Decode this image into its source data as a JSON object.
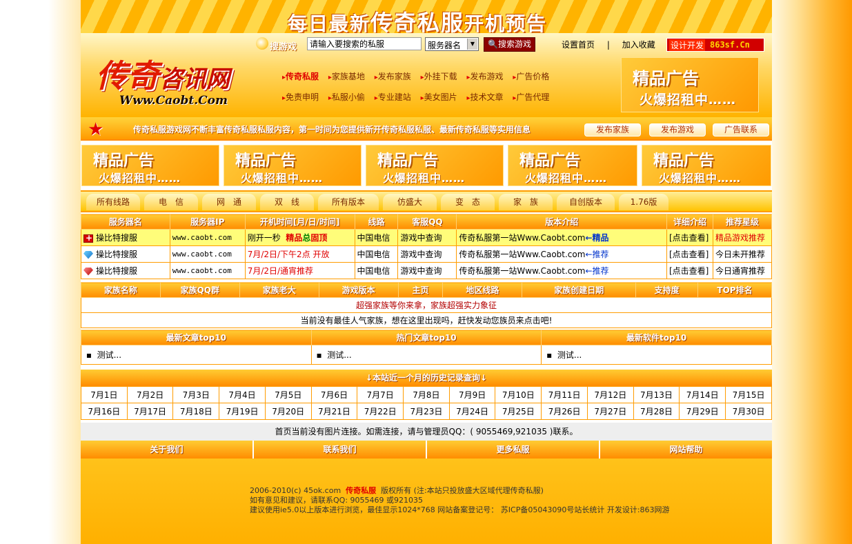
{
  "banner": {
    "title_pre": "每日最新",
    "title_main": "传奇私服",
    "title_post": "开机预告"
  },
  "logo": {
    "cn": "传奇",
    "cn_small": "咨讯网",
    "url": "Www.Caobt.Com"
  },
  "search": {
    "label": "搜游戏",
    "placeholder": "请输入要搜索的私服",
    "select_value": "服务器名",
    "button": "搜索游戏"
  },
  "top_links": [
    "设置首页",
    "|",
    "加入收藏"
  ],
  "dev": {
    "label": "设计开发",
    "site": "863sf.Cn"
  },
  "nav": {
    "row1": [
      "传奇私服",
      "家族基地",
      "发布家族",
      "外挂下载",
      "发布游戏",
      "广告价格"
    ],
    "row2": [
      "免责申明",
      "私服小偷",
      "专业建站",
      "美女图片",
      "技术文章",
      "广告代理"
    ]
  },
  "ad": {
    "line1": "精品广告",
    "line2": "火爆招租中……"
  },
  "notice": {
    "text": "传奇私服游戏网不断丰富传奇私服私服内容，第一时间为您提供新开传奇私服私服、最新传奇私服等实用信息",
    "buttons": [
      "发布家族",
      "发布游戏",
      "广告联系"
    ]
  },
  "filters": [
    "所有线路",
    "电　信",
    "网　通",
    "双　线",
    "所有版本",
    "仿盛大",
    "变　态",
    "家　族",
    "自创版本",
    "1.76版"
  ],
  "servers": {
    "headers": [
      "服务器名",
      "服务器IP",
      "开机时间[月/日/时间]",
      "线路",
      "客服QQ",
      "版本介绍",
      "详细介绍",
      "推荐星级"
    ],
    "rows": [
      {
        "name": "操比特搜服",
        "ip": "www.caobt.com",
        "time_a": "刚开一秒",
        "time_b": "精品",
        "time_c": "总",
        "time_d": "固顶",
        "line": "中国电信",
        "qq": "游戏中查询",
        "intro": "传奇私服第一站Www.Caobt.com",
        "intro_tag": "←精品",
        "detail": "[点击查看]",
        "rec": "精品游戏推荐"
      },
      {
        "name": "操比特搜服",
        "ip": "www.caobt.com",
        "time_a": "7月/2日/下午2点 开放",
        "line": "中国电信",
        "qq": "游戏中查询",
        "intro": "传奇私服第一站Www.Caobt.com",
        "intro_tag": "←推荐",
        "detail": "[点击查看]",
        "rec": "今日未开推荐"
      },
      {
        "name": "操比特搜服",
        "ip": "www.caobt.com",
        "time_a": "7月/2日/通宵推荐",
        "line": "中国电信",
        "qq": "游戏中查询",
        "intro": "传奇私服第一站Www.Caobt.com",
        "intro_tag": "←推荐",
        "detail": "[点击查看]",
        "rec": "今日通宵推荐"
      }
    ]
  },
  "family": {
    "headers": [
      "家族名称",
      "家族QQ群",
      "家族老大",
      "游戏版本",
      "主页",
      "地区线路",
      "家族创建日期",
      "支持度",
      "TOP排名"
    ],
    "line1": "超强家族等你来拿，家族超强实力象征",
    "line2": "当前没有最佳人气家族，想在这里出现吗，赶快发动您族员来点击吧!"
  },
  "top10": {
    "headers": [
      "最新文章top10",
      "热门文章top10",
      "最新软件top10"
    ],
    "items": [
      "测试...",
      "测试...",
      "测试..."
    ]
  },
  "history": {
    "title": "本站近一个月的历史记录查询",
    "row1": [
      "7月1日",
      "7月2日",
      "7月3日",
      "7月4日",
      "7月5日",
      "7月6日",
      "7月7日",
      "7月8日",
      "7月9日",
      "7月10日",
      "7月11日",
      "7月12日",
      "7月13日",
      "7月14日",
      "7月15日"
    ],
    "row2": [
      "7月16日",
      "7月17日",
      "7月18日",
      "7月19日",
      "7月20日",
      "7月21日",
      "7月22日",
      "7月23日",
      "7月24日",
      "7月25日",
      "7月26日",
      "7月27日",
      "7月28日",
      "7月29日",
      "7月30日"
    ]
  },
  "notice2": "首页当前没有图片连接。如需连接，请与管理员QQ：( 9055469,921035 )联系。",
  "foot_nav": [
    "关于我们",
    "联系我们",
    "更多私服",
    "网站帮助"
  ],
  "footer": {
    "l1a": "2006-2010(c) 45ok.com",
    "l1b": "传奇私服",
    "l1c": "版权所有 (注:本站只投放盛大区域代理传奇私服)",
    "l2": "如有意见和建议，请联系QQ: 9055469 或921035",
    "l3": "建议使用ie5.0以上版本进行浏览，最佳显示1024*768 网站备案登记号： 苏ICP备05043090号站长统计 开发设计:863网游"
  },
  "colors": {
    "accent": "#ff9c00",
    "red": "#e00000",
    "blue": "#0033cc"
  }
}
